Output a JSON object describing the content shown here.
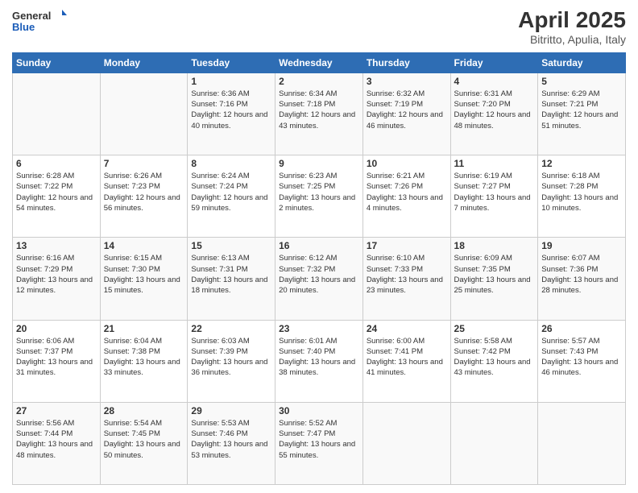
{
  "header": {
    "logo_general": "General",
    "logo_blue": "Blue",
    "title": "April 2025",
    "subtitle": "Bitritto, Apulia, Italy"
  },
  "calendar": {
    "days_of_week": [
      "Sunday",
      "Monday",
      "Tuesday",
      "Wednesday",
      "Thursday",
      "Friday",
      "Saturday"
    ],
    "weeks": [
      [
        {
          "day": "",
          "info": ""
        },
        {
          "day": "",
          "info": ""
        },
        {
          "day": "1",
          "info": "Sunrise: 6:36 AM\nSunset: 7:16 PM\nDaylight: 12 hours and 40 minutes."
        },
        {
          "day": "2",
          "info": "Sunrise: 6:34 AM\nSunset: 7:18 PM\nDaylight: 12 hours and 43 minutes."
        },
        {
          "day": "3",
          "info": "Sunrise: 6:32 AM\nSunset: 7:19 PM\nDaylight: 12 hours and 46 minutes."
        },
        {
          "day": "4",
          "info": "Sunrise: 6:31 AM\nSunset: 7:20 PM\nDaylight: 12 hours and 48 minutes."
        },
        {
          "day": "5",
          "info": "Sunrise: 6:29 AM\nSunset: 7:21 PM\nDaylight: 12 hours and 51 minutes."
        }
      ],
      [
        {
          "day": "6",
          "info": "Sunrise: 6:28 AM\nSunset: 7:22 PM\nDaylight: 12 hours and 54 minutes."
        },
        {
          "day": "7",
          "info": "Sunrise: 6:26 AM\nSunset: 7:23 PM\nDaylight: 12 hours and 56 minutes."
        },
        {
          "day": "8",
          "info": "Sunrise: 6:24 AM\nSunset: 7:24 PM\nDaylight: 12 hours and 59 minutes."
        },
        {
          "day": "9",
          "info": "Sunrise: 6:23 AM\nSunset: 7:25 PM\nDaylight: 13 hours and 2 minutes."
        },
        {
          "day": "10",
          "info": "Sunrise: 6:21 AM\nSunset: 7:26 PM\nDaylight: 13 hours and 4 minutes."
        },
        {
          "day": "11",
          "info": "Sunrise: 6:19 AM\nSunset: 7:27 PM\nDaylight: 13 hours and 7 minutes."
        },
        {
          "day": "12",
          "info": "Sunrise: 6:18 AM\nSunset: 7:28 PM\nDaylight: 13 hours and 10 minutes."
        }
      ],
      [
        {
          "day": "13",
          "info": "Sunrise: 6:16 AM\nSunset: 7:29 PM\nDaylight: 13 hours and 12 minutes."
        },
        {
          "day": "14",
          "info": "Sunrise: 6:15 AM\nSunset: 7:30 PM\nDaylight: 13 hours and 15 minutes."
        },
        {
          "day": "15",
          "info": "Sunrise: 6:13 AM\nSunset: 7:31 PM\nDaylight: 13 hours and 18 minutes."
        },
        {
          "day": "16",
          "info": "Sunrise: 6:12 AM\nSunset: 7:32 PM\nDaylight: 13 hours and 20 minutes."
        },
        {
          "day": "17",
          "info": "Sunrise: 6:10 AM\nSunset: 7:33 PM\nDaylight: 13 hours and 23 minutes."
        },
        {
          "day": "18",
          "info": "Sunrise: 6:09 AM\nSunset: 7:35 PM\nDaylight: 13 hours and 25 minutes."
        },
        {
          "day": "19",
          "info": "Sunrise: 6:07 AM\nSunset: 7:36 PM\nDaylight: 13 hours and 28 minutes."
        }
      ],
      [
        {
          "day": "20",
          "info": "Sunrise: 6:06 AM\nSunset: 7:37 PM\nDaylight: 13 hours and 31 minutes."
        },
        {
          "day": "21",
          "info": "Sunrise: 6:04 AM\nSunset: 7:38 PM\nDaylight: 13 hours and 33 minutes."
        },
        {
          "day": "22",
          "info": "Sunrise: 6:03 AM\nSunset: 7:39 PM\nDaylight: 13 hours and 36 minutes."
        },
        {
          "day": "23",
          "info": "Sunrise: 6:01 AM\nSunset: 7:40 PM\nDaylight: 13 hours and 38 minutes."
        },
        {
          "day": "24",
          "info": "Sunrise: 6:00 AM\nSunset: 7:41 PM\nDaylight: 13 hours and 41 minutes."
        },
        {
          "day": "25",
          "info": "Sunrise: 5:58 AM\nSunset: 7:42 PM\nDaylight: 13 hours and 43 minutes."
        },
        {
          "day": "26",
          "info": "Sunrise: 5:57 AM\nSunset: 7:43 PM\nDaylight: 13 hours and 46 minutes."
        }
      ],
      [
        {
          "day": "27",
          "info": "Sunrise: 5:56 AM\nSunset: 7:44 PM\nDaylight: 13 hours and 48 minutes."
        },
        {
          "day": "28",
          "info": "Sunrise: 5:54 AM\nSunset: 7:45 PM\nDaylight: 13 hours and 50 minutes."
        },
        {
          "day": "29",
          "info": "Sunrise: 5:53 AM\nSunset: 7:46 PM\nDaylight: 13 hours and 53 minutes."
        },
        {
          "day": "30",
          "info": "Sunrise: 5:52 AM\nSunset: 7:47 PM\nDaylight: 13 hours and 55 minutes."
        },
        {
          "day": "",
          "info": ""
        },
        {
          "day": "",
          "info": ""
        },
        {
          "day": "",
          "info": ""
        }
      ]
    ]
  }
}
